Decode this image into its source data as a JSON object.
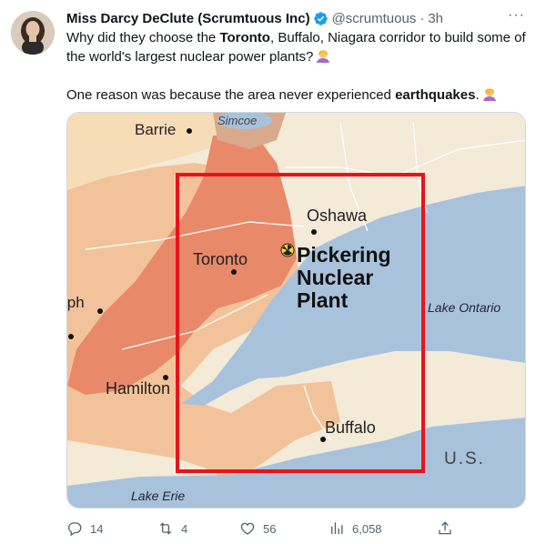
{
  "tweet": {
    "author_name": "Miss Darcy DeClute (Scrumtuous Inc)",
    "handle": "@scrumtuous",
    "separator": "·",
    "time": "3h",
    "more_label": "···",
    "line1_prefix": "Why did they choose the ",
    "line1_bold": "Toronto",
    "line1_suffix": ", Buffalo, Niagara corridor to build some of the world's largest nuclear power plants?",
    "line2_prefix": "One reason was because the area never experienced ",
    "line2_bold": "earthquakes",
    "line2_suffix": "."
  },
  "map": {
    "labels": {
      "barrie": "Barrie",
      "simcoe": "Simcoe",
      "oshawa": "Oshawa",
      "toronto": "Toronto",
      "pickering_1": "Pickering",
      "pickering_2": "Nuclear",
      "pickering_3": "Plant",
      "guelph": "lph",
      "lake_ontario": "Lake Ontario",
      "hamilton": "Hamilton",
      "buffalo": "Buffalo",
      "us": "U.S.",
      "lake_erie": "Lake Erie"
    },
    "colors": {
      "land": "#f3ead8",
      "water": "#a9c2dc",
      "urban_dark": "#e8896a",
      "urban_light": "#f2c39a",
      "highlight_box": "#e8131b"
    }
  },
  "actions": {
    "replies": "14",
    "retweets": "4",
    "likes": "56",
    "views": "6,058"
  },
  "icons": [
    "verified-badge-icon",
    "more-icon",
    "reply-icon",
    "retweet-icon",
    "like-icon",
    "views-icon",
    "share-icon",
    "radiation-icon"
  ]
}
